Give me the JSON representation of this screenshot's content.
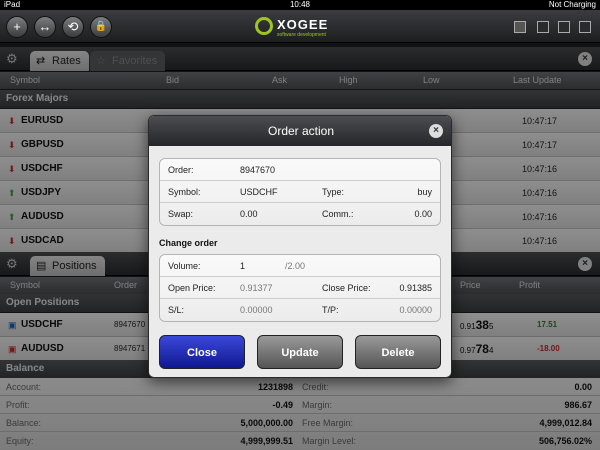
{
  "statusbar": {
    "device": "iPad",
    "time": "10:48",
    "battery": "Not Charging"
  },
  "toolbar": {
    "buttons": [
      "+",
      "↔",
      "⟲",
      "🔒"
    ],
    "logo_name": "XOGEE",
    "logo_tagline": "software development"
  },
  "rates_panel": {
    "tabs": [
      {
        "label": "Rates",
        "active": true
      },
      {
        "label": "Favorites",
        "active": false
      }
    ],
    "columns": {
      "symbol": "Symbol",
      "bid": "Bid",
      "ask": "Ask",
      "high": "High",
      "low": "Low",
      "last_update": "Last Update"
    },
    "section": "Forex Majors",
    "rows": [
      {
        "symbol": "EURUSD",
        "direction": "down",
        "time": "10:47:17"
      },
      {
        "symbol": "GBPUSD",
        "direction": "down",
        "time": "10:47:17"
      },
      {
        "symbol": "USDCHF",
        "direction": "down",
        "time": "10:47:16"
      },
      {
        "symbol": "USDJPY",
        "direction": "up",
        "time": "10:47:16"
      },
      {
        "symbol": "AUDUSD",
        "direction": "up",
        "time": "10:47:16"
      },
      {
        "symbol": "USDCAD",
        "direction": "down",
        "time": "10:47:16"
      }
    ]
  },
  "positions_panel": {
    "tab": "Positions",
    "columns": {
      "symbol": "Symbol",
      "order": "Order",
      "price": "Price",
      "profit": "Profit"
    },
    "section": "Open Positions",
    "rows": [
      {
        "symbol": "USDCHF",
        "order": "8947670",
        "price_small": "0.91",
        "price_big": "38",
        "price_sup": "5",
        "profit": "17.51",
        "profit_sign": "pos"
      },
      {
        "symbol": "AUDUSD",
        "order": "8947671",
        "price_small": "0.97",
        "price_big": "78",
        "price_sup": "4",
        "profit": "-18.00",
        "profit_sign": "neg"
      }
    ]
  },
  "balance": {
    "section": "Balance",
    "left": [
      {
        "label": "Account:",
        "value": "1231898"
      },
      {
        "label": "Profit:",
        "value": "-0.49"
      },
      {
        "label": "Balance:",
        "value": "5,000,000.00"
      },
      {
        "label": "Equity:",
        "value": "4,999,999.51"
      }
    ],
    "right": [
      {
        "label": "Credit:",
        "value": "0.00"
      },
      {
        "label": "Margin:",
        "value": "986.67"
      },
      {
        "label": "Free Margin:",
        "value": "4,999,012.84"
      },
      {
        "label": "Margin Level:",
        "value": "506,756.02%"
      }
    ]
  },
  "modal": {
    "title": "Order action",
    "order_label": "Order:",
    "order_value": "8947670",
    "symbol_label": "Symbol:",
    "symbol_value": "USDCHF",
    "type_label": "Type:",
    "type_value": "buy",
    "swap_label": "Swap:",
    "swap_value": "0.00",
    "comm_label": "Comm.:",
    "comm_value": "0.00",
    "change_order": "Change order",
    "volume_label": "Volume:",
    "volume_value": "1",
    "volume_max": "/2.00",
    "open_price_label": "Open Price:",
    "open_price_value": "0.91377",
    "close_price_label": "Close Price:",
    "close_price_value": "0.91385",
    "sl_label": "S/L:",
    "sl_value": "0.00000",
    "tp_label": "T/P:",
    "tp_value": "0.00000",
    "buttons": {
      "close": "Close",
      "update": "Update",
      "delete": "Delete"
    }
  }
}
